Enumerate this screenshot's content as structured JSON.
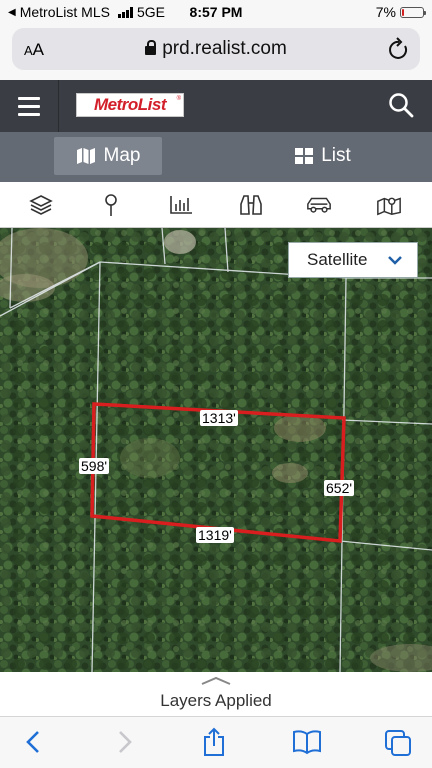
{
  "status_bar": {
    "carrier": "MetroList MLS",
    "network": "5GE",
    "time": "8:57 PM",
    "battery": "7%"
  },
  "browser": {
    "text_size_label": "AA",
    "url": "prd.realist.com"
  },
  "header": {
    "logo_text": "MetroList",
    "logo_mark": "®"
  },
  "view_toggle": {
    "map_label": "Map",
    "list_label": "List"
  },
  "tools": [
    "layers-icon",
    "location-pin-icon",
    "bar-chart-icon",
    "binoculars-icon",
    "car-icon",
    "map-area-icon"
  ],
  "map": {
    "basemap_select": "Satellite",
    "dimensions": {
      "top": "1313'",
      "left": "598'",
      "right": "652'",
      "bottom": "1319'"
    },
    "parcel_outline_color": "#d81e1e"
  },
  "layers_panel": {
    "label": "Layers Applied"
  },
  "colors": {
    "header_bg": "#3a3d43",
    "view_bar_bg": "#646a74",
    "link_blue": "#1f6fd6"
  }
}
